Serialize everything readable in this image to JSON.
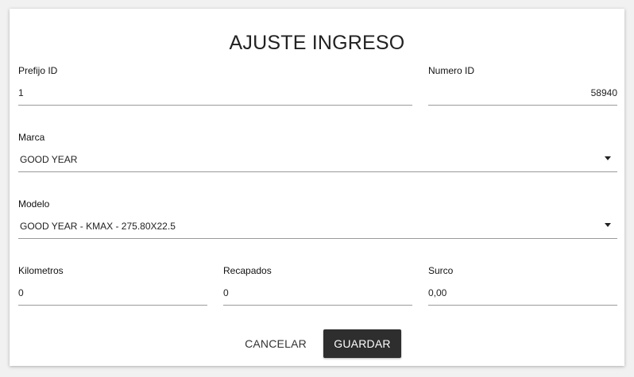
{
  "dialog": {
    "title": "AJUSTE INGRESO",
    "fields": {
      "prefijo": {
        "label": "Prefijo ID",
        "value": "1"
      },
      "numero": {
        "label": "Numero ID",
        "value": "58940"
      },
      "marca": {
        "label": "Marca",
        "value": "GOOD YEAR"
      },
      "modelo": {
        "label": "Modelo",
        "value": "GOOD YEAR - KMAX - 275.80X22.5"
      },
      "kilometros": {
        "label": "Kilometros",
        "value": "0"
      },
      "recapados": {
        "label": "Recapados",
        "value": "0"
      },
      "surco": {
        "label": "Surco",
        "value": "0,00"
      }
    },
    "actions": {
      "cancel_label": "CANCELAR",
      "save_label": "GUARDAR"
    }
  },
  "icons": {
    "dropdown": "dropdown-arrow-icon"
  },
  "colors": {
    "background": "#f1f1f1",
    "dialog": "#ffffff",
    "primary_button": "#2e2e2e",
    "underline": "#9a9a9a"
  }
}
